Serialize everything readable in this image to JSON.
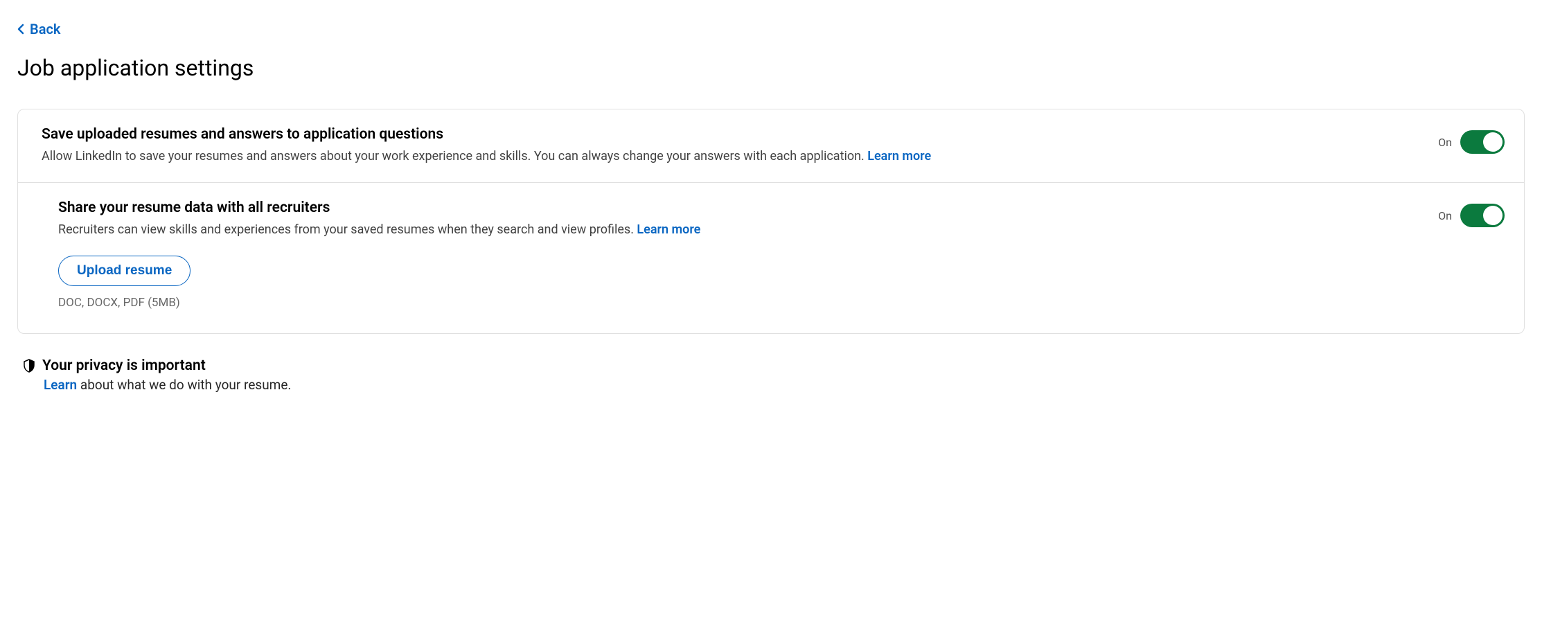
{
  "back": {
    "label": "Back"
  },
  "page": {
    "title": "Job application settings"
  },
  "settings": {
    "saveResumes": {
      "title": "Save uploaded resumes and answers to application questions",
      "description": "Allow LinkedIn to save your resumes and answers about your work experience and skills. You can always change your answers with each application. ",
      "learnMore": "Learn more",
      "stateLabel": "On"
    },
    "shareResume": {
      "title": "Share your resume data with all recruiters",
      "description": "Recruiters can view skills and experiences from your saved resumes when they search and view profiles. ",
      "learnMore": "Learn more",
      "stateLabel": "On",
      "uploadLabel": "Upload resume",
      "uploadHint": "DOC, DOCX, PDF (5MB)"
    }
  },
  "privacy": {
    "title": "Your privacy is important",
    "learn": "Learn",
    "rest": " about what we do with your resume."
  }
}
